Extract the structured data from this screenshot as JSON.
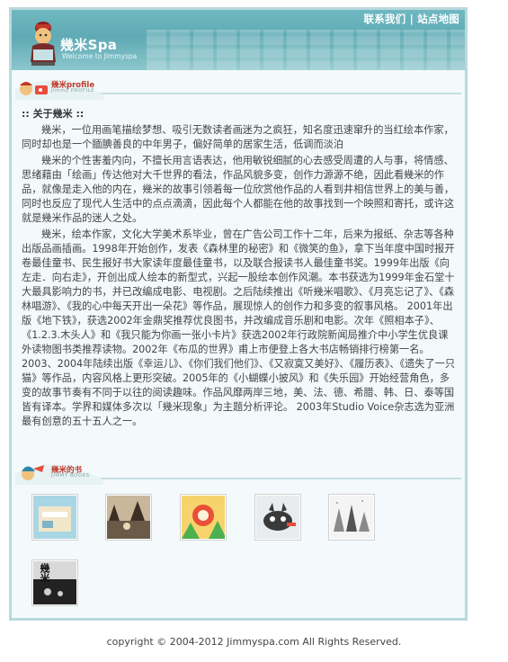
{
  "header": {
    "links": [
      "联系我们",
      "站点地图"
    ],
    "separator": "|",
    "logo_title": "幾米Spa",
    "logo_subtitle": "Welcome to Jimmyspa"
  },
  "profile_section": {
    "title": "幾米profile",
    "subtitle": "Jimmy PROFILE",
    "about_heading": ":: 关于幾米 ::",
    "paragraphs": [
      "幾米，一位用画笔描绘梦想、吸引无数读者画迷为之疯狂，知名度迅速窜升的当红绘本作家，同时却也是一个腼腆善良的中年男子，偏好简单的居家生活，低调而淡泊",
      "幾米的个性害羞内向，不擅长用言语表达，他用敏锐细腻的心去感受周遭的人与事，将情感、思绪藉由「绘画」传达他对大千世界的看法，作品风貌多变，创作力源源不绝，因此看幾米的作品，就像是走入他的内在，幾米的故事引领着每一位欣赏他作品的人看到井相信世界上的美与善，同时也反应了现代人生活中的点点滴滴，因此每个人都能在他的故事找到一个映照和寄托，或许这就是幾米作品的迷人之处。",
      "幾米，绘本作家，文化大学美术系毕业，曾在广告公司工作十二年，后来为报纸、杂志等各种出版品画插画。1998年开始创作，发表《森林里的秘密》和《微笑的鱼》，拿下当年度中国时报开卷最佳童书、民生报好书大家读年度最佳童书，以及联合报读书人最佳童书奖。1999年出版《向左走．向右走》，开创出成人绘本的新型式，兴起一股绘本创作风潮。本书获选为1999年金石堂十大最具影响力的书，并已改编成电影、电视剧。之后陆续推出《听幾米唱歌》、《月亮忘记了》、《森林唱游》、《我的心中每天开出一朵花》等作品，展现惊人的创作力和多变的叙事风格。 2001年出版《地下铁》，获选2002年金鼎奖推荐优良图书，并改编成音乐剧和电影。次年《照相本子》、《1.2.3.木头人》和《我只能为你画一张小卡片》获选2002年行政院新闻局推介中小学生优良课外读物图书类推荐读物。2002年《布瓜的世界》甫上市便登上各大书店畅销排行榜第一名。 2003、2004年陆续出版《幸运儿》、《你们我们他们》、《又寂寞又美好》、《履历表》、《遗失了一只猫》等作品，内容风格上更形突破。2005年的《小蝴蝶小披风》和《失乐园》开始经营角色，多变的故事节奏有不同于以往的阅读趣味。作品风靡两岸三地，美、法、德、希腊、韩、日、泰等国皆有译本。学界和媒体多次以「幾米现象」为主题分析评论。 2003年Studio Voice杂志选为亚洲最有创意的五十五人之一。"
    ]
  },
  "books_section": {
    "title": "幾米的书",
    "subtitle": "JIMMY BOOKS",
    "books": [
      {
        "name": "book-cover-1",
        "palette": [
          "#a9d6e5",
          "#f2e6c9"
        ]
      },
      {
        "name": "book-cover-2",
        "palette": [
          "#6b5a48",
          "#c9b79c"
        ]
      },
      {
        "name": "book-cover-3",
        "palette": [
          "#e94f37",
          "#4caf50"
        ]
      },
      {
        "name": "book-cover-4",
        "palette": [
          "#e8ecee",
          "#3a3a3a"
        ]
      },
      {
        "name": "book-cover-5",
        "palette": [
          "#f4f4f4",
          "#555555"
        ]
      },
      {
        "name": "book-cover-6",
        "palette": [
          "#d9d9d9",
          "#222222"
        ],
        "text": "幾米"
      }
    ]
  },
  "footer": {
    "copyright": "copyright © 2004-2012 Jimmyspa.com All Rights Reserved."
  },
  "colors": {
    "header_teal": "#6fb8c2",
    "frame_border": "#b9d9dc",
    "section_title_red": "#c0392b"
  }
}
